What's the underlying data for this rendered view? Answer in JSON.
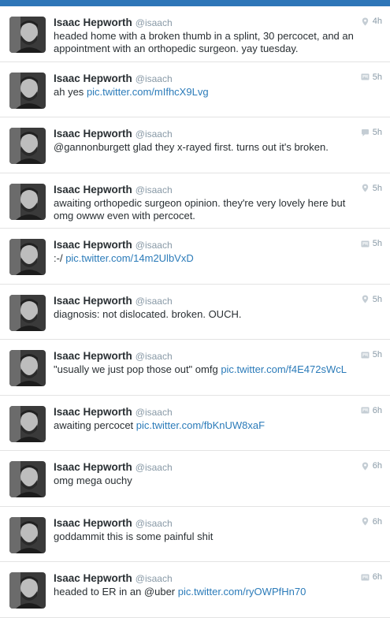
{
  "colors": {
    "topbar": "#2e76b8",
    "link": "#2b7bb9",
    "name": "#292f33",
    "meta": "#8899a6"
  },
  "tweets": [
    {
      "name": "Isaac Hepworth",
      "handle": "@isaach",
      "text": "headed home with a broken thumb in a splint, 30 percocet, and an appointment with an orthopedic surgeon. yay tuesday.",
      "link": "",
      "time": "4h",
      "icon": "location-pin-icon"
    },
    {
      "name": "Isaac Hepworth",
      "handle": "@isaach",
      "text": "ah yes",
      "link": "pic.twitter.com/mIfhcX9Lvg",
      "time": "5h",
      "icon": "photo-icon"
    },
    {
      "name": "Isaac Hepworth",
      "handle": "@isaach",
      "text": "@gannonburgett glad they x-rayed first. turns out it's broken.",
      "link": "",
      "time": "5h",
      "icon": "conversation-icon"
    },
    {
      "name": "Isaac Hepworth",
      "handle": "@isaach",
      "text": "awaiting orthopedic surgeon opinion. they're very lovely here but omg owww even with percocet.",
      "link": "",
      "time": "5h",
      "icon": "location-pin-icon"
    },
    {
      "name": "Isaac Hepworth",
      "handle": "@isaach",
      "text": ":-/",
      "link": "pic.twitter.com/14m2UlbVxD",
      "time": "5h",
      "icon": "photo-icon"
    },
    {
      "name": "Isaac Hepworth",
      "handle": "@isaach",
      "text": "diagnosis: not dislocated. broken. OUCH.",
      "link": "",
      "time": "5h",
      "icon": "location-pin-icon"
    },
    {
      "name": "Isaac Hepworth",
      "handle": "@isaach",
      "text": "\"usually we just pop those out\" omfg",
      "link": "pic.twitter.com/f4E472sWcL",
      "time": "5h",
      "icon": "photo-icon"
    },
    {
      "name": "Isaac Hepworth",
      "handle": "@isaach",
      "text": "awaiting percocet",
      "link": "pic.twitter.com/fbKnUW8xaF",
      "time": "6h",
      "icon": "photo-icon"
    },
    {
      "name": "Isaac Hepworth",
      "handle": "@isaach",
      "text": "omg mega ouchy",
      "link": "",
      "time": "6h",
      "icon": "location-pin-icon"
    },
    {
      "name": "Isaac Hepworth",
      "handle": "@isaach",
      "text": "goddammit this is some painful shit",
      "link": "",
      "time": "6h",
      "icon": "location-pin-icon"
    },
    {
      "name": "Isaac Hepworth",
      "handle": "@isaach",
      "text": "headed to ER in an @uber",
      "link": "pic.twitter.com/ryOWPfHn70",
      "time": "6h",
      "icon": "photo-icon"
    }
  ]
}
